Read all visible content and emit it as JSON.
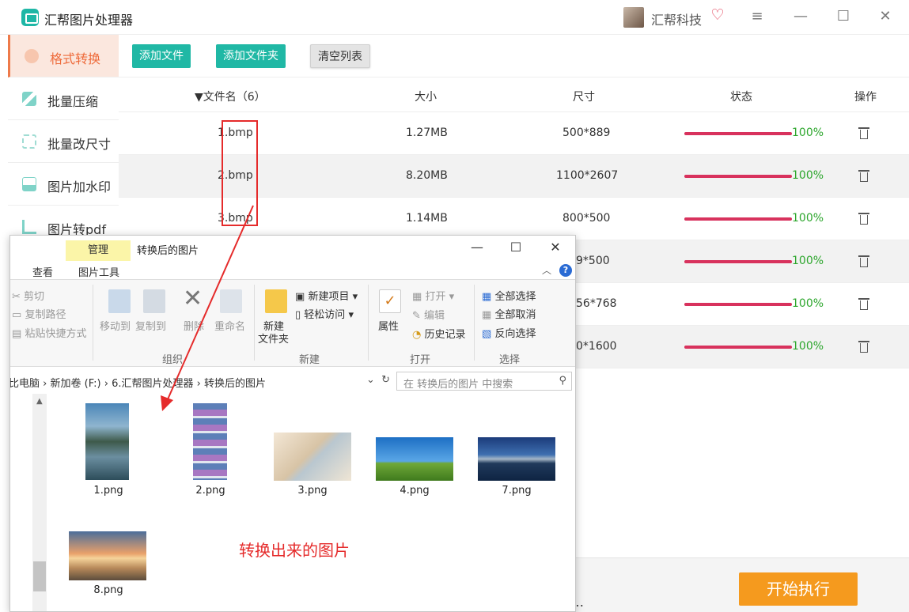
{
  "app": {
    "title": "汇帮图片处理器",
    "user_name": "汇帮科技"
  },
  "window_controls": {
    "menu": "≡",
    "minimize": "—",
    "maximize": "☐",
    "close": "✕"
  },
  "sidebar": {
    "items": [
      {
        "label": "格式转换",
        "icon": "format-convert-icon",
        "active": true
      },
      {
        "label": "批量压缩",
        "icon": "compress-icon",
        "active": false
      },
      {
        "label": "批量改尺寸",
        "icon": "resize-icon",
        "active": false
      },
      {
        "label": "图片加水印",
        "icon": "watermark-icon",
        "active": false
      },
      {
        "label": "图片转pdf",
        "icon": "pdf-icon",
        "active": false
      }
    ]
  },
  "toolbar": {
    "add_file": "添加文件",
    "add_folder": "添加文件夹",
    "clear_list": "清空列表"
  },
  "table": {
    "headers": {
      "name": "▼文件名（6）",
      "size": "大小",
      "dimensions": "尺寸",
      "status": "状态",
      "action": "操作"
    },
    "rows": [
      {
        "name": "1.bmp",
        "size": "1.27MB",
        "dimensions": "500*889",
        "progress": "100%"
      },
      {
        "name": "2.bmp",
        "size": "8.20MB",
        "dimensions": "1100*2607",
        "progress": "100%"
      },
      {
        "name": "3.bmp",
        "size": "1.14MB",
        "dimensions": "800*500",
        "progress": "100%"
      },
      {
        "name": "",
        "size": "",
        "dimensions": "9*500",
        "progress": "100%"
      },
      {
        "name": "",
        "size": "",
        "dimensions": "56*768",
        "progress": "100%"
      },
      {
        "name": "",
        "size": "",
        "dimensions": "0*1600",
        "progress": "100%"
      }
    ]
  },
  "bottom": {
    "start_button": "开始执行",
    "more": "…"
  },
  "explorer": {
    "manage_tab": "管理",
    "title": "转换后的图片",
    "tabs": {
      "view": "查看",
      "picture_tools": "图片工具"
    },
    "ribbon": {
      "cut": "剪切",
      "copy_path": "复制路径",
      "paste_shortcut": "粘贴快捷方式",
      "move_to": "移动到",
      "copy_to": "复制到",
      "delete": "删除",
      "rename": "重命名",
      "group_organize": "组织",
      "new_folder": "新建\n文件夹",
      "new_folder_1": "新建",
      "new_folder_2": "文件夹",
      "new_item": "新建项目",
      "easy_access": "轻松访问",
      "group_new": "新建",
      "properties": "属性",
      "open": "打开",
      "edit": "编辑",
      "history": "历史记录",
      "group_open": "打开",
      "select_all": "全部选择",
      "select_none": "全部取消",
      "invert_selection": "反向选择",
      "group_select": "选择"
    },
    "address": {
      "path": [
        "比电脑",
        "新加卷 (F:)",
        "6.汇帮图片处理器",
        "转换后的图片"
      ],
      "search_placeholder": "在 转换后的图片 中搜索"
    },
    "files": [
      "1.png",
      "2.png",
      "3.png",
      "4.png",
      "7.png",
      "8.png"
    ]
  },
  "annotation": {
    "label": "转换出来的图片",
    "color": "#e52b2b"
  },
  "colors": {
    "teal": "#20b8a5",
    "progress": "#d8325d",
    "percent": "#2aa52a",
    "start": "#f59a1e",
    "accent": "#ee6b3b"
  }
}
